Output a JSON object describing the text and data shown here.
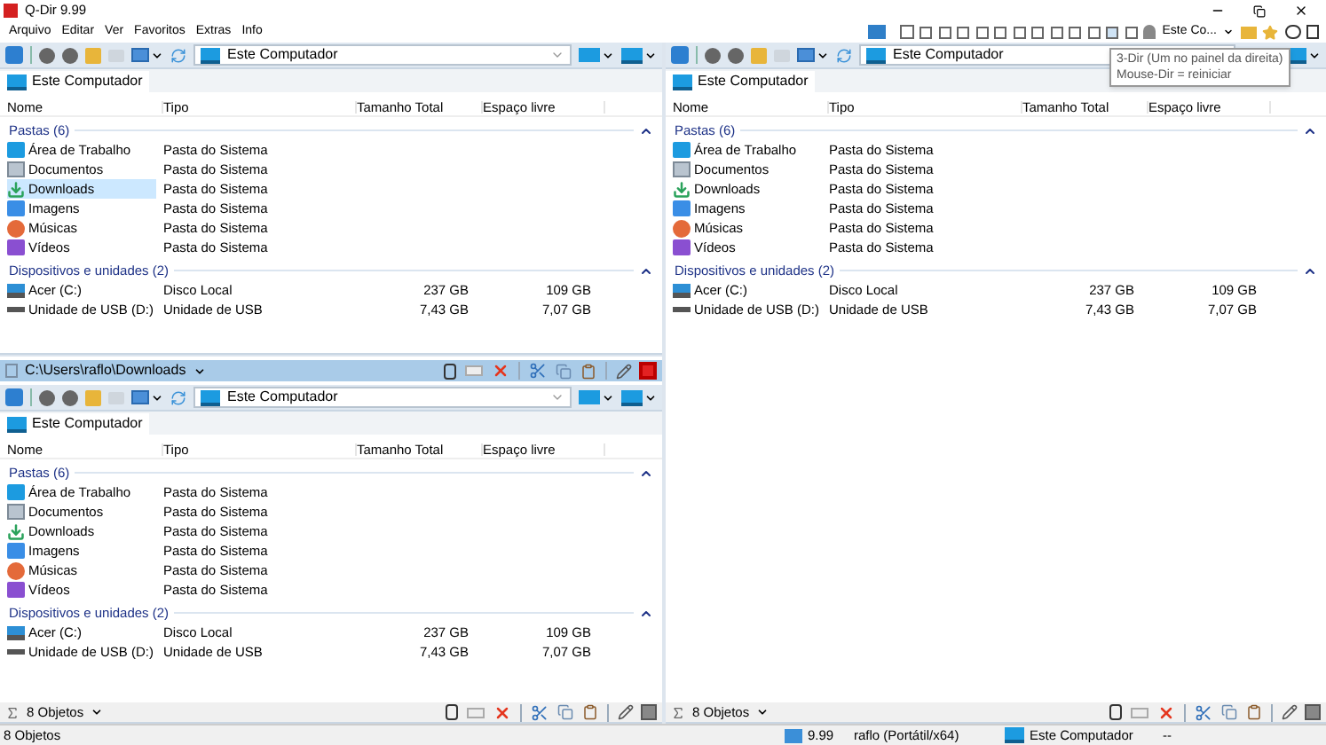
{
  "window": {
    "title": "Q-Dir 9.99"
  },
  "menu": [
    "Arquivo",
    "Editar",
    "Ver",
    "Favoritos",
    "Extras",
    "Info"
  ],
  "top_toolbar": {
    "location_label": "Este Co...",
    "tooltip": [
      "3-Dir (Um no painel da direita)",
      "Mouse-Dir = reiniciar"
    ]
  },
  "left_column": [
    {
      "address": "Este Computador",
      "tab": "Este Computador",
      "columns": [
        "Nome",
        "Tipo",
        "Tamanho Total",
        "Espaço livre"
      ],
      "groups": [
        {
          "label": "Pastas (6)",
          "items": [
            {
              "kind": "desktop",
              "name": "Área de Trabalho",
              "type": "Pasta do Sistema",
              "selected": false
            },
            {
              "kind": "documents",
              "name": "Documentos",
              "type": "Pasta do Sistema",
              "selected": false
            },
            {
              "kind": "downloads",
              "name": "Downloads",
              "type": "Pasta do Sistema",
              "selected": true
            },
            {
              "kind": "images",
              "name": "Imagens",
              "type": "Pasta do Sistema",
              "selected": false
            },
            {
              "kind": "music",
              "name": "Músicas",
              "type": "Pasta do Sistema",
              "selected": false
            },
            {
              "kind": "videos",
              "name": "Vídeos",
              "type": "Pasta do Sistema",
              "selected": false
            }
          ]
        },
        {
          "label": "Dispositivos e unidades (2)",
          "items": [
            {
              "kind": "drive",
              "name": "Acer (C:)",
              "type": "Disco Local",
              "total": "237 GB",
              "free": "109 GB",
              "selected": false
            },
            {
              "kind": "usb",
              "name": "Unidade de USB (D:)",
              "type": "Unidade de USB",
              "total": "7,43 GB",
              "free": "7,07 GB",
              "selected": false
            }
          ]
        }
      ]
    },
    {
      "header": "C:\\Users\\raflo\\Downloads",
      "address": "Este Computador",
      "tab": "Este Computador",
      "columns": [
        "Nome",
        "Tipo",
        "Tamanho Total",
        "Espaço livre"
      ],
      "groups": [
        {
          "label": "Pastas (6)",
          "items": [
            {
              "kind": "desktop",
              "name": "Área de Trabalho",
              "type": "Pasta do Sistema",
              "selected": false
            },
            {
              "kind": "documents",
              "name": "Documentos",
              "type": "Pasta do Sistema",
              "selected": false
            },
            {
              "kind": "downloads",
              "name": "Downloads",
              "type": "Pasta do Sistema",
              "selected": false
            },
            {
              "kind": "images",
              "name": "Imagens",
              "type": "Pasta do Sistema",
              "selected": false
            },
            {
              "kind": "music",
              "name": "Músicas",
              "type": "Pasta do Sistema",
              "selected": false
            },
            {
              "kind": "videos",
              "name": "Vídeos",
              "type": "Pasta do Sistema",
              "selected": false
            }
          ]
        },
        {
          "label": "Dispositivos e unidades (2)",
          "items": [
            {
              "kind": "drive",
              "name": "Acer (C:)",
              "type": "Disco Local",
              "total": "237 GB",
              "free": "109 GB",
              "selected": false
            },
            {
              "kind": "usb",
              "name": "Unidade de USB (D:)",
              "type": "Unidade de USB",
              "total": "7,43 GB",
              "free": "7,07 GB",
              "selected": false
            }
          ]
        }
      ],
      "footer": "8 Objetos"
    }
  ],
  "right_column": [
    {
      "address": "Este Computador",
      "tab": "Este Computador",
      "columns": [
        "Nome",
        "Tipo",
        "Tamanho Total",
        "Espaço livre"
      ],
      "groups": [
        {
          "label": "Pastas (6)",
          "items": [
            {
              "kind": "desktop",
              "name": "Área de Trabalho",
              "type": "Pasta do Sistema",
              "selected": false
            },
            {
              "kind": "documents",
              "name": "Documentos",
              "type": "Pasta do Sistema",
              "selected": false
            },
            {
              "kind": "downloads",
              "name": "Downloads",
              "type": "Pasta do Sistema",
              "selected": false
            },
            {
              "kind": "images",
              "name": "Imagens",
              "type": "Pasta do Sistema",
              "selected": false
            },
            {
              "kind": "music",
              "name": "Músicas",
              "type": "Pasta do Sistema",
              "selected": false
            },
            {
              "kind": "videos",
              "name": "Vídeos",
              "type": "Pasta do Sistema",
              "selected": false
            }
          ]
        },
        {
          "label": "Dispositivos e unidades (2)",
          "items": [
            {
              "kind": "drive",
              "name": "Acer (C:)",
              "type": "Disco Local",
              "total": "237 GB",
              "free": "109 GB",
              "selected": false
            },
            {
              "kind": "usb",
              "name": "Unidade de USB (D:)",
              "type": "Unidade de USB",
              "total": "7,43 GB",
              "free": "7,07 GB",
              "selected": false
            }
          ]
        }
      ],
      "footer": "8 Objetos"
    }
  ],
  "status_bar": {
    "objects": "8 Objetos",
    "version": "9.99",
    "user": "raflo (Portátil/x64)",
    "location": "Este Computador",
    "extra": "--"
  }
}
